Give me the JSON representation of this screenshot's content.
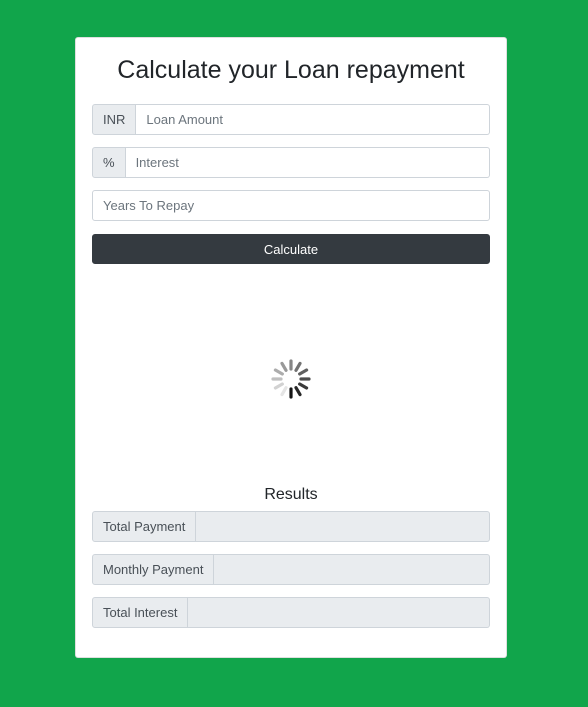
{
  "form": {
    "title": "Calculate your Loan repayment",
    "loan_amount": {
      "addon": "INR",
      "placeholder": "Loan Amount",
      "value": ""
    },
    "interest": {
      "addon": "%",
      "placeholder": "Interest",
      "value": ""
    },
    "years": {
      "placeholder": "Years To Repay",
      "value": ""
    },
    "calculate_label": "Calculate"
  },
  "loading": {
    "icon": "loading-spinner-icon"
  },
  "results": {
    "title": "Results",
    "total_payment": {
      "label": "Total Payment",
      "value": ""
    },
    "monthly_payment": {
      "label": "Monthly Payment",
      "value": ""
    },
    "total_interest": {
      "label": "Total Interest",
      "value": ""
    }
  },
  "colors": {
    "background": "#11a54b",
    "button": "#343a40",
    "addon": "#e9ecef"
  }
}
